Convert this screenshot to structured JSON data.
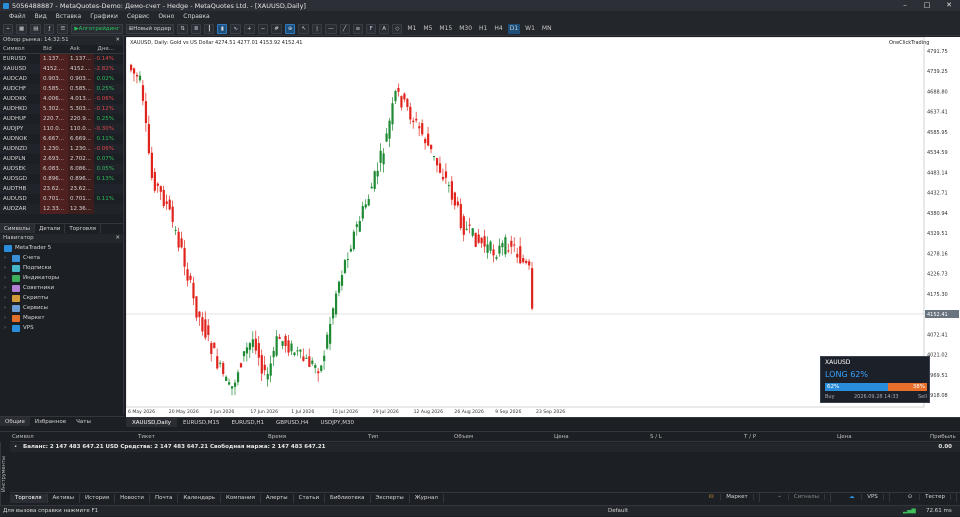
{
  "window": {
    "title": "5056488887 - MetaQuotes-Demo: Демо-счет - Hedge - MetaQuotes Ltd. - [XAUUSD,Daily]"
  },
  "menu": [
    "Файл",
    "Вид",
    "Вставка",
    "Графики",
    "Сервис",
    "Окно",
    "Справка"
  ],
  "toolbar": {
    "algo": "Алготрейдинг",
    "new_order": "Новый ордер",
    "timeframes": [
      "M1",
      "M5",
      "M15",
      "M30",
      "H1",
      "H4",
      "D1",
      "W1",
      "MN"
    ],
    "active_tf": "D1"
  },
  "market_watch": {
    "title": "Обзор рынка: 14:32:51",
    "columns": [
      "Символ",
      "Bid",
      "Ask",
      "Дне..."
    ],
    "rows": [
      {
        "symbol": "EURUSD",
        "bid": "1.137...",
        "ask": "1.137...",
        "change": "-0.14%",
        "neg": true
      },
      {
        "symbol": "XAUUSD",
        "bid": "4152....",
        "ask": "4152....",
        "change": "-2.82%",
        "neg": true
      },
      {
        "symbol": "AUDCAD",
        "bid": "0.903...",
        "ask": "0.903...",
        "change": "0.02%",
        "neg": false
      },
      {
        "symbol": "AUDCHF",
        "bid": "0.585...",
        "ask": "0.585...",
        "change": "0.25%",
        "neg": false
      },
      {
        "symbol": "AUDDKK",
        "bid": "4.006...",
        "ask": "4.013...",
        "change": "-0.06%",
        "neg": true
      },
      {
        "symbol": "AUDHKD",
        "bid": "5.302...",
        "ask": "5.303...",
        "change": "-0.12%",
        "neg": true
      },
      {
        "symbol": "AUDHUF",
        "bid": "220.7...",
        "ask": "220.9...",
        "change": "0.25%",
        "neg": false
      },
      {
        "symbol": "AUDJPY",
        "bid": "110.0...",
        "ask": "110.0...",
        "change": "-0.30%",
        "neg": true
      },
      {
        "symbol": "AUDNOK",
        "bid": "6.667...",
        "ask": "6.669...",
        "change": "0.11%",
        "neg": false
      },
      {
        "symbol": "AUDNZD",
        "bid": "1.230...",
        "ask": "1.230...",
        "change": "-0.06%",
        "neg": true
      },
      {
        "symbol": "AUDPLN",
        "bid": "2.693...",
        "ask": "2.702...",
        "change": "0.07%",
        "neg": false
      },
      {
        "symbol": "AUDSEK",
        "bid": "6.083...",
        "ask": "6.086...",
        "change": "0.05%",
        "neg": false
      },
      {
        "symbol": "AUDSGD",
        "bid": "0.896...",
        "ask": "0.896...",
        "change": "0.13%",
        "neg": false
      },
      {
        "symbol": "AUDTHB",
        "bid": "23.62...",
        "ask": "23.62...",
        "change": "",
        "neg": false
      },
      {
        "symbol": "AUDUSD",
        "bid": "0.701...",
        "ask": "0.701...",
        "change": "0.11%",
        "neg": false
      },
      {
        "symbol": "AUDZAR",
        "bid": "12.33...",
        "ask": "12.36...",
        "change": "",
        "neg": false
      }
    ],
    "tabs": [
      "Символы",
      "Детали",
      "Торговля"
    ]
  },
  "navigator": {
    "title": "Навигатор",
    "root": "MetaTrader 5",
    "items": [
      "Счета",
      "Подписки",
      "Индикаторы",
      "Советники",
      "Скрипты",
      "Сервисы",
      "Маркет",
      "VPS"
    ],
    "tabs": [
      "Общие",
      "Избранное",
      "Чаты"
    ]
  },
  "chart": {
    "label": "XAUUSD, Daily:  Gold vs US Dollar  4274.51 4277.01 4153.92 4152.41",
    "one_click": "OneClickTrading",
    "symbol_tabs": [
      "XAUUSD,Daily",
      "EURUSD,M15",
      "EURUSD,H1",
      "GBPUSD,H4",
      "USDJPY,M30"
    ],
    "price_labels": [
      "4791.75",
      "4739.25",
      "4688.80",
      "4637.41",
      "4585.95",
      "4534.59",
      "4483.14",
      "4432.71",
      "4380.94",
      "4329.51",
      "4278.16",
      "4226.73",
      "4175.30",
      "4124.07",
      "4072.41",
      "4021.02",
      "3969.51",
      "3918.08"
    ],
    "current_price": "4152.41",
    "date_labels": [
      "6 May 2026",
      "20 May 2026",
      "3 Jun 2026",
      "17 Jun 2026",
      "1 Jul 2026",
      "15 Jul 2026",
      "29 Jul 2026",
      "12 Aug 2026",
      "26 Aug 2026",
      "9 Sep 2026",
      "23 Sep 2026"
    ]
  },
  "trade_panel": {
    "symbol": "XAUUSD",
    "title": "LONG 62%",
    "long": "62%",
    "short": "38%",
    "long_pct": 62,
    "buy": "Buy",
    "time": "2026.09.28 14:33",
    "sell": "Sell"
  },
  "toolbox": {
    "columns": [
      "Символ",
      "Тикет",
      "Время",
      "Тип",
      "Объем",
      "Цена",
      "S / L",
      "T / P",
      "Цена",
      "Прибыль"
    ],
    "balance_line": "Баланс: 2 147 483 647.21 USD  Средства: 2 147 483 647.21  Свободная маржа: 2 147 483 647.21",
    "profit": "0.00",
    "vertical_tab": "Инструменты",
    "tabs": [
      "Торговля",
      "Активы",
      "История",
      "Новости",
      "Почта",
      "Календарь",
      "Компания",
      "Алерты",
      "Статьи",
      "Библиотека",
      "Эксперты",
      "Журнал"
    ],
    "right_links": [
      "Маркет",
      "Сигналы",
      "VPS",
      "Тестер"
    ]
  },
  "status": {
    "help": "Для вызова справки нажмите F1",
    "profile": "Default",
    "ping": "72.61 ms"
  },
  "colors": {
    "bull": "#1e8a33",
    "bear": "#e0241d",
    "accent": "#2a8ddb"
  }
}
